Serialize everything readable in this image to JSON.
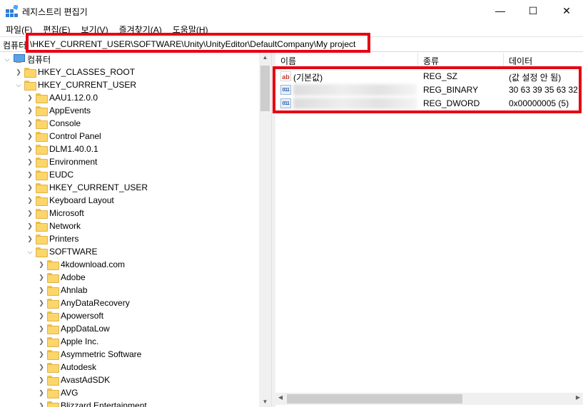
{
  "window": {
    "title": "레지스트리 편집기",
    "min_glyph": "—",
    "max_glyph": "☐",
    "close_glyph": "✕",
    "icon": "registry-icon"
  },
  "menu": [
    "파일(F)",
    "편집(E)",
    "보기(V)",
    "즐겨찾기(A)",
    "도움말(H)"
  ],
  "address": {
    "prefix": "컴퓨터",
    "path": "\\HKEY_CURRENT_USER\\SOFTWARE\\Unity\\UnityEditor\\DefaultCompany\\My project"
  },
  "tree": {
    "root": "컴퓨터",
    "hkeys": [
      "HKEY_CLASSES_ROOT",
      "HKEY_CURRENT_USER"
    ],
    "hkcu_children": [
      "AAU1.12.0.0",
      "AppEvents",
      "Console",
      "Control Panel",
      "DLM1.40.0.1",
      "Environment",
      "EUDC",
      "HKEY_CURRENT_USER",
      "Keyboard Layout",
      "Microsoft",
      "Network",
      "Printers",
      "SOFTWARE"
    ],
    "software_children": [
      "4kdownload.com",
      "Adobe",
      "Ahnlab",
      "AnyDataRecovery",
      "Apowersoft",
      "AppDataLow",
      "Apple Inc.",
      "Asymmetric Software",
      "Autodesk",
      "AvastAdSDK",
      "AVG",
      "Blizzard Entertainment"
    ]
  },
  "columns": {
    "name": "이름",
    "type": "종류",
    "data": "데이터"
  },
  "values": [
    {
      "icon": "string-value-icon",
      "name": "(기본값)",
      "type": "REG_SZ",
      "data": "(값 설정 안 됨)"
    },
    {
      "icon": "binary-value-icon",
      "name": "",
      "type": "REG_BINARY",
      "data": "30 63 39 35 63 32"
    },
    {
      "icon": "binary-value-icon",
      "name": "",
      "type": "REG_DWORD",
      "data": "0x00000005 (5)"
    }
  ],
  "colors": {
    "highlight": "#e60012",
    "folder": "#fcd66a"
  }
}
